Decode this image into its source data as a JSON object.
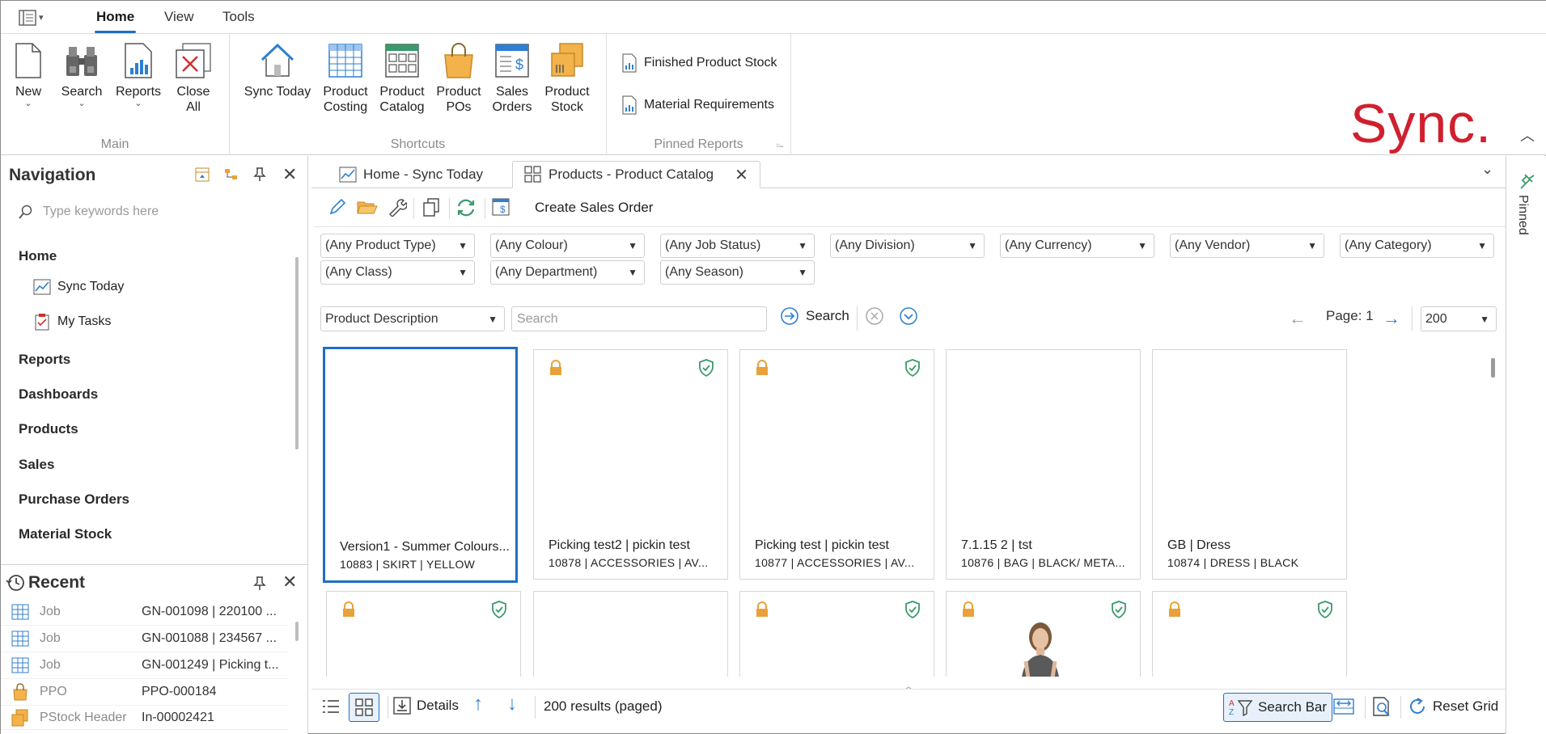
{
  "ribbon": {
    "tabs": [
      "Home",
      "View",
      "Tools"
    ],
    "groups": {
      "main": {
        "label": "Main",
        "buttons": {
          "new": "New",
          "search": "Search",
          "reports": "Reports",
          "close_all_1": "Close",
          "close_all_2": "All"
        }
      },
      "shortcuts": {
        "label": "Shortcuts",
        "buttons": {
          "sync_today": "Sync Today",
          "product_costing_1": "Product",
          "product_costing_2": "Costing",
          "product_catalog_1": "Product",
          "product_catalog_2": "Catalog",
          "product_pos_1": "Product",
          "product_pos_2": "POs",
          "sales_orders_1": "Sales",
          "sales_orders_2": "Orders",
          "product_stock_1": "Product",
          "product_stock_2": "Stock"
        }
      },
      "pinned_reports": {
        "label": "Pinned Reports",
        "items": [
          "Finished Product Stock",
          "Material Requirements"
        ]
      }
    },
    "logo": "Sync."
  },
  "navigation": {
    "title": "Navigation",
    "search_placeholder": "Type keywords here",
    "sections": {
      "home": "Home",
      "home_items": [
        "Sync Today",
        "My Tasks"
      ],
      "reports": "Reports",
      "dashboards": "Dashboards",
      "products": "Products",
      "sales": "Sales",
      "purchase_orders": "Purchase Orders",
      "material_stock": "Material Stock"
    }
  },
  "recent": {
    "title": "Recent",
    "rows": [
      {
        "type": "Job",
        "value": "GN-001098 | 220100 ..."
      },
      {
        "type": "Job",
        "value": "GN-001088 | 234567 ..."
      },
      {
        "type": "Job",
        "value": "GN-001249 | Picking t..."
      },
      {
        "type": "PPO",
        "value": "PPO-000184"
      },
      {
        "type": "PStock Header",
        "value": "In-00002421"
      }
    ]
  },
  "doc_tabs": [
    "Home - Sync Today",
    "Products - Product Catalog"
  ],
  "toolbar": {
    "create_sales_order": "Create Sales Order"
  },
  "filters": {
    "product_type": "(Any Product Type)",
    "colour": "(Any Colour)",
    "job_status": "(Any Job Status)",
    "division": "(Any Division)",
    "currency": "(Any Currency)",
    "vendor": "(Any Vendor)",
    "category": "(Any Category)",
    "class": "(Any Class)",
    "department": "(Any Department)",
    "season": "(Any Season)"
  },
  "search": {
    "field": "Product Description",
    "placeholder": "Search",
    "button": "Search",
    "page_label": "Page: 1",
    "page_size": "200"
  },
  "cards": [
    {
      "title": "Version1 - Summer Colours...",
      "meta": "10883 | SKIRT | YELLOW"
    },
    {
      "title": "Picking test2 | pickin test",
      "meta": "10878 | ACCESSORIES | AV..."
    },
    {
      "title": "Picking test | pickin test",
      "meta": "10877 | ACCESSORIES | AV..."
    },
    {
      "title": "7.1.15 2 | tst",
      "meta": "10876 | BAG | BLACK/ META..."
    },
    {
      "title": "GB | Dress",
      "meta": "10874 | DRESS | BLACK"
    }
  ],
  "bottom": {
    "details": "Details",
    "results": "200 results (paged)",
    "search_bar": "Search Bar",
    "reset_grid": "Reset Grid"
  },
  "pinned_label": "Pinned",
  "colors": {
    "accent": "#1e6fc4",
    "logo": "#d0202e",
    "lock": "#e9a13b",
    "shield": "#3a9a6a"
  }
}
